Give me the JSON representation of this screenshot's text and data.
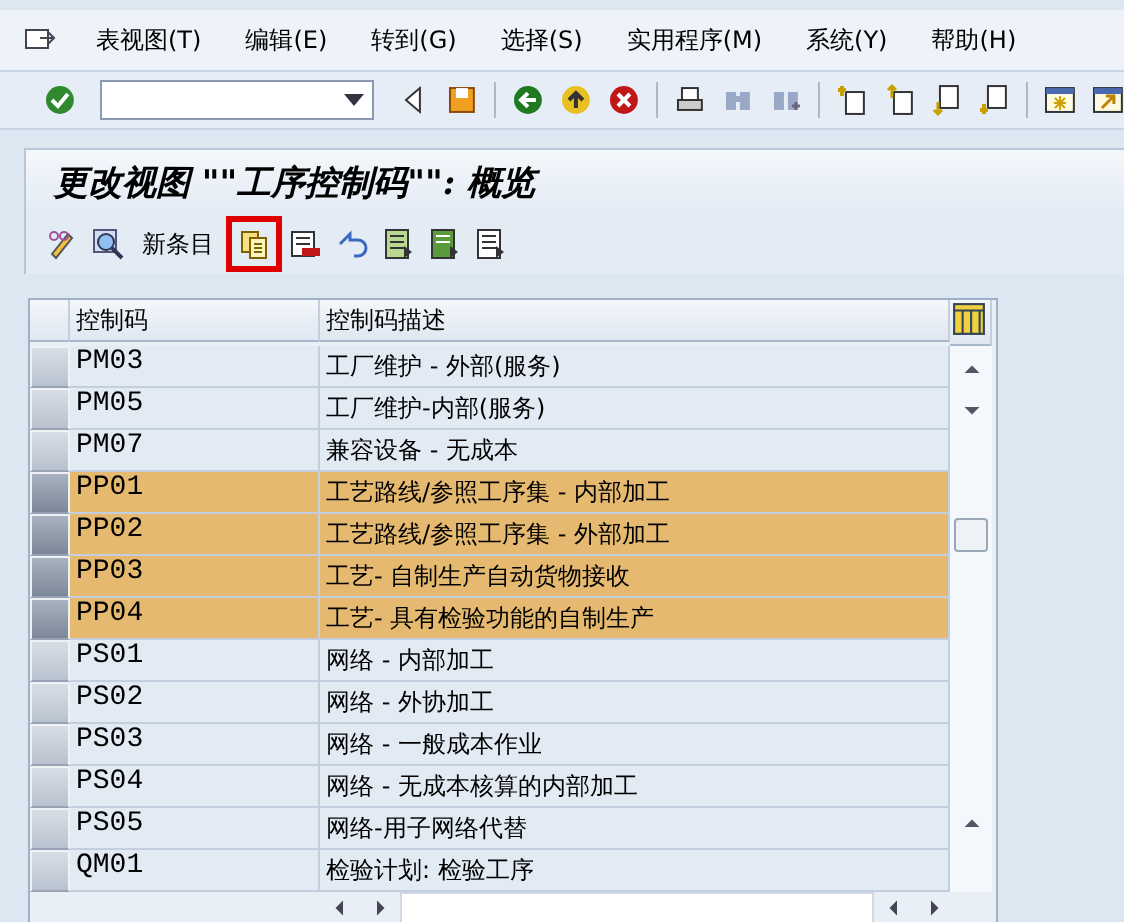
{
  "menu": [
    "表视图(T)",
    "编辑(E)",
    "转到(G)",
    "选择(S)",
    "实用程序(M)",
    "系统(Y)",
    "帮助(H)"
  ],
  "title": "更改视图 \"\"工序控制码\"\": 概览",
  "app_toolbar": {
    "new_entries": "新条目",
    "copy_highlighted": true
  },
  "table": {
    "columns": [
      "控制码",
      "控制码描述"
    ],
    "rows": [
      {
        "code": "PM03",
        "description": "工厂维护 - 外部(服务)",
        "selected": false
      },
      {
        "code": "PM05",
        "description": "工厂维护-内部(服务)",
        "selected": false
      },
      {
        "code": "PM07",
        "description": "兼容设备 - 无成本",
        "selected": false
      },
      {
        "code": "PP01",
        "description": "工艺路线/参照工序集 - 内部加工",
        "selected": true
      },
      {
        "code": "PP02",
        "description": "工艺路线/参照工序集 - 外部加工",
        "selected": true
      },
      {
        "code": "PP03",
        "description": "工艺- 自制生产自动货物接收",
        "selected": true
      },
      {
        "code": "PP04",
        "description": "工艺- 具有检验功能的自制生产",
        "selected": true
      },
      {
        "code": "PS01",
        "description": "网络 - 内部加工",
        "selected": false
      },
      {
        "code": "PS02",
        "description": "网络 - 外协加工",
        "selected": false
      },
      {
        "code": "PS03",
        "description": "网络 - 一般成本作业",
        "selected": false
      },
      {
        "code": "PS04",
        "description": "网络 - 无成本核算的内部加工",
        "selected": false
      },
      {
        "code": "PS05",
        "description": "网络-用子网络代替",
        "selected": false
      },
      {
        "code": "QM01",
        "description": "检验计划: 检验工序",
        "selected": false
      }
    ]
  }
}
